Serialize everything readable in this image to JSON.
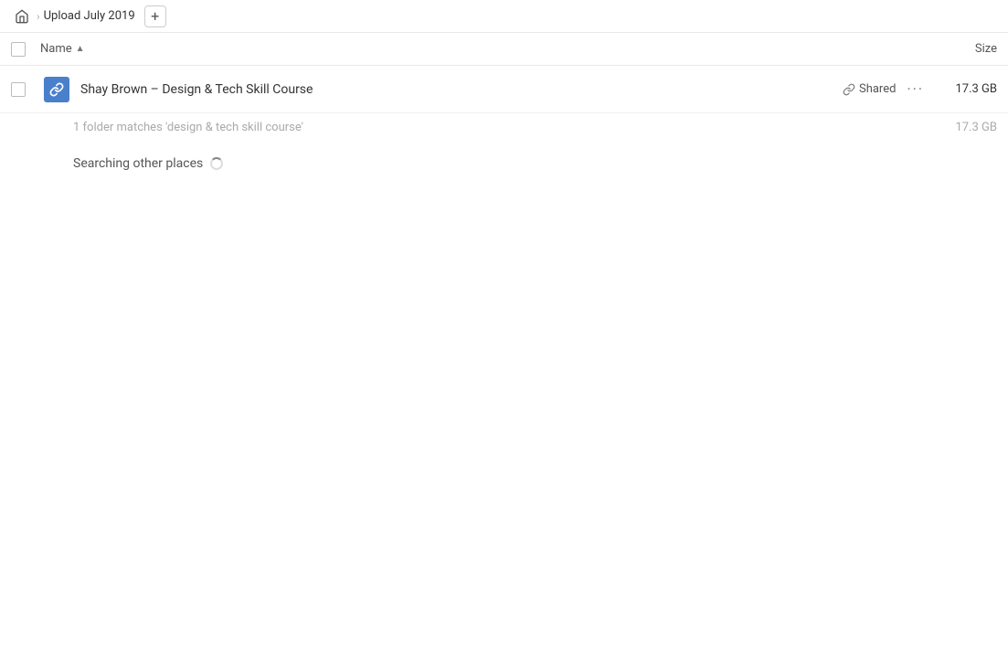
{
  "breadcrumb": {
    "home_icon": "🏠",
    "separator": "›",
    "title": "Upload July 2019",
    "add_button": "+"
  },
  "columns": {
    "name_label": "Name",
    "sort_arrow": "▲",
    "size_label": "Size"
  },
  "file_row": {
    "folder_icon_char": "✏",
    "name": "Shay Brown – Design & Tech Skill Course",
    "shared_label": "Shared",
    "size": "17.3 GB"
  },
  "summary": {
    "text": "1 folder matches 'design & tech skill course'",
    "size": "17.3 GB"
  },
  "searching": {
    "label": "Searching other places"
  }
}
